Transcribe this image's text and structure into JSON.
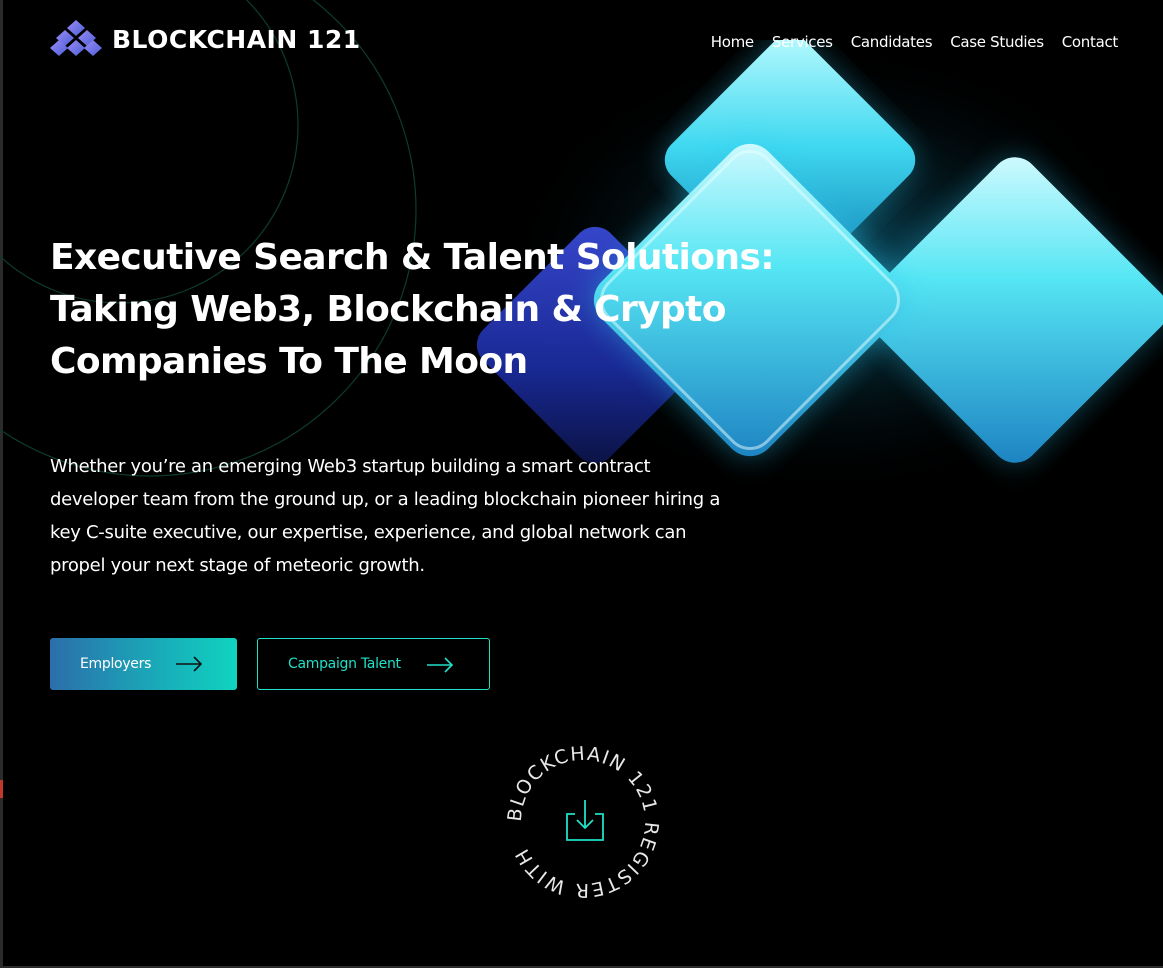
{
  "brand": {
    "name": "BLOCKCHAIN 121"
  },
  "nav": {
    "items": [
      {
        "label": "Home"
      },
      {
        "label": "Services"
      },
      {
        "label": "Candidates"
      },
      {
        "label": "Case Studies"
      },
      {
        "label": "Contact"
      }
    ]
  },
  "hero": {
    "headline_lines": [
      "Executive Search & Talent Solutions:",
      "Taking Web3, Blockchain & Crypto",
      "Companies To The Moon"
    ],
    "subtext_lines": [
      "Whether you’re an emerging Web3 startup building a smart contract",
      "developer team from the ground up, or a leading blockchain pioneer hiring a",
      "key C-suite executive, our expertise, experience, and global network can",
      "propel your next stage of meteoric growth."
    ],
    "buttons": {
      "employers": "Employers",
      "campaign_talent": "Campaign Talent"
    }
  },
  "register_badge": {
    "circular_text": "BLOCKCHAIN 121 REGISTER WITH ",
    "icon": "download-icon"
  },
  "colors": {
    "background": "#000000",
    "accent": "#1fe0c8",
    "gradient_start": "#2b6eaa",
    "gradient_end": "#0fd4c0"
  }
}
